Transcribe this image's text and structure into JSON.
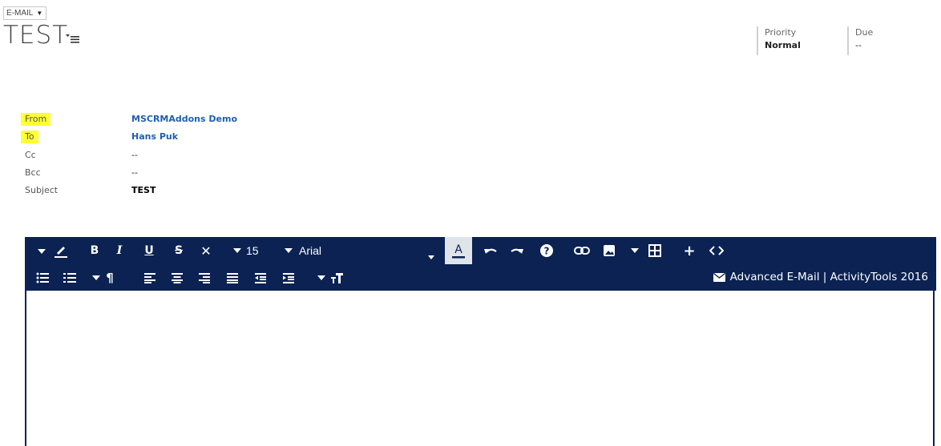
{
  "header": {
    "entity_type": "E-MAIL",
    "title": "TEST",
    "fields": [
      {
        "label": "Priority",
        "value": "Normal"
      },
      {
        "label": "Due",
        "value": "--"
      }
    ]
  },
  "form": {
    "rows": [
      {
        "label": "From",
        "value": "MSCRMAddons Demo",
        "highlighted": true,
        "style": "link"
      },
      {
        "label": "To",
        "value": "Hans Puk",
        "highlighted": true,
        "style": "link"
      },
      {
        "label": "Cc",
        "value": "--",
        "highlighted": false,
        "style": "plain"
      },
      {
        "label": "Bcc",
        "value": "--",
        "highlighted": false,
        "style": "plain"
      },
      {
        "label": "Subject",
        "value": "TEST",
        "highlighted": false,
        "style": "bold"
      }
    ],
    "highlight_color": "#ffff33",
    "link_color": "#1f5fae"
  },
  "editor": {
    "toolbar_color": "#0b2253",
    "font_size": "15",
    "font_family": "Arial",
    "brand_label": "Advanced E-Mail | ActivityTools 2016",
    "row1_icons": [
      "caret-down-icon",
      "highlight-pen-icon",
      "bold-icon",
      "italic-icon",
      "underline-icon",
      "strikethrough-icon",
      "clear-format-icon",
      "font-size-dropdown",
      "font-family-dropdown",
      "font-color-icon",
      "undo-icon",
      "redo-icon",
      "help-icon",
      "link-icon",
      "image-icon",
      "table-icon",
      "insert-icon",
      "code-view-icon"
    ],
    "row2_icons": [
      "bullet-list-icon",
      "numbered-list-icon",
      "paragraph-icon",
      "align-left-icon",
      "align-center-icon",
      "align-right-icon",
      "align-justify-icon",
      "outdent-icon",
      "indent-icon",
      "line-height-icon",
      "envelope-icon"
    ]
  }
}
